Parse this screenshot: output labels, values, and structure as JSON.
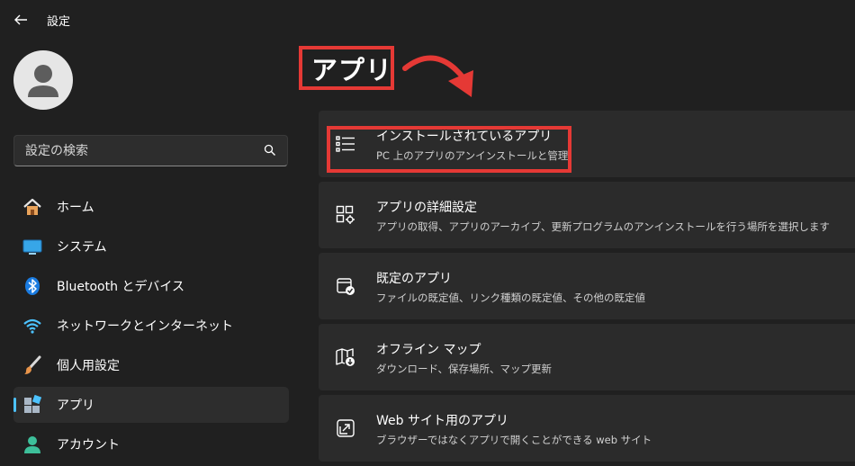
{
  "window": {
    "title": "設定"
  },
  "search": {
    "placeholder": "設定の検索"
  },
  "sidebar": {
    "items": [
      {
        "label": "ホーム",
        "icon": "home-icon"
      },
      {
        "label": "システム",
        "icon": "system-icon"
      },
      {
        "label": "Bluetooth とデバイス",
        "icon": "bluetooth-icon"
      },
      {
        "label": "ネットワークとインターネット",
        "icon": "network-icon"
      },
      {
        "label": "個人用設定",
        "icon": "brush-icon"
      },
      {
        "label": "アプリ",
        "icon": "apps-icon",
        "selected": true
      },
      {
        "label": "アカウント",
        "icon": "account-icon"
      }
    ]
  },
  "main": {
    "heading": "アプリ",
    "cards": [
      {
        "title": "インストールされているアプリ",
        "description": "PC 上のアプリのアンインストールと管理",
        "icon": "list-icon"
      },
      {
        "title": "アプリの詳細設定",
        "description": "アプリの取得、アプリのアーカイブ、更新プログラムのアンインストールを行う場所を選択します",
        "icon": "apps-gear-icon"
      },
      {
        "title": "既定のアプリ",
        "description": "ファイルの既定値、リンク種類の既定値、その他の既定値",
        "icon": "default-app-icon"
      },
      {
        "title": "オフライン マップ",
        "description": "ダウンロード、保存場所、マップ更新",
        "icon": "map-download-icon"
      },
      {
        "title": "Web サイト用のアプリ",
        "description": "ブラウザーではなくアプリで開くことができる web サイト",
        "icon": "open-external-icon"
      }
    ]
  },
  "colors": {
    "accent": "#4cc2ff",
    "annotation": "#e53935",
    "background": "#202020",
    "card": "#2b2b2b"
  }
}
